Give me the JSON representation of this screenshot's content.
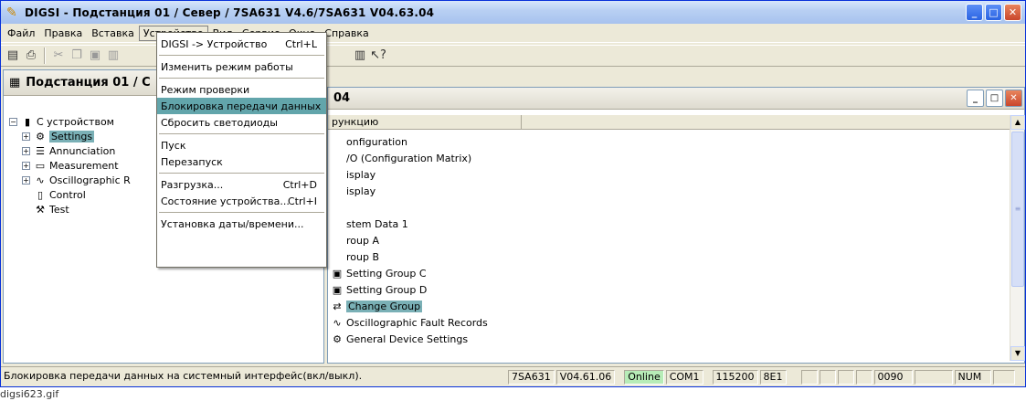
{
  "window": {
    "title": "DIGSI - Подстанция 01 / Север / 7SA631 V4.6/7SA631 V04.63.04"
  },
  "menubar": [
    "Файл",
    "Правка",
    "Вставка",
    "Устройство",
    "Вид",
    "Сервис",
    "Окно",
    "Справка"
  ],
  "left_panel": {
    "title": "Подстанция 01 / С",
    "tree": [
      {
        "label": "С устройством",
        "icon": "device-icon"
      },
      {
        "label": "Settings",
        "icon": "settings-icon"
      },
      {
        "label": "Annunciation",
        "icon": "annunciation-icon"
      },
      {
        "label": "Measurement",
        "icon": "measurement-icon"
      },
      {
        "label": "Oscillographic R",
        "icon": "oscillograph-icon"
      },
      {
        "label": "Control",
        "icon": "control-icon"
      },
      {
        "label": "Test",
        "icon": "test-icon"
      }
    ]
  },
  "right_panel": {
    "title": "04",
    "column_header": "рункцию",
    "items": [
      "onfiguration",
      "/O (Configuration Matrix)",
      "isplay",
      "isplay",
      "",
      "stem Data 1",
      "roup A",
      "roup B",
      "Setting Group C",
      "Setting Group D",
      "Change Group",
      "Oscillographic Fault Records",
      "General Device Settings"
    ]
  },
  "dropdown": {
    "items": [
      {
        "label": "DIGSI -> Устройство",
        "shortcut": "Ctrl+L"
      },
      {
        "label": "Изменить режим работы",
        "shortcut": ""
      },
      {
        "label": "Режим проверки",
        "shortcut": ""
      },
      {
        "label": "Блокировка передачи данных",
        "shortcut": ""
      },
      {
        "label": "Сбросить светодиоды",
        "shortcut": ""
      },
      {
        "label": "Пуск",
        "shortcut": ""
      },
      {
        "label": "Перезапуск",
        "shortcut": ""
      },
      {
        "label": "Разгрузка...",
        "shortcut": "Ctrl+D"
      },
      {
        "label": "Состояние устройства...",
        "shortcut": "Ctrl+I"
      },
      {
        "label": "Установка даты/времени...",
        "shortcut": ""
      }
    ]
  },
  "statusbar": {
    "message": "Блокировка передачи данных на системный интерфейс(вкл/выкл).",
    "device": "7SA631",
    "version": "V04.61.06",
    "mode": "Online",
    "port": "COM1",
    "baud": "115200",
    "frame": "8E1",
    "num1": "0090",
    "num_lock": "NUM"
  },
  "caption": "digsi623.gif"
}
